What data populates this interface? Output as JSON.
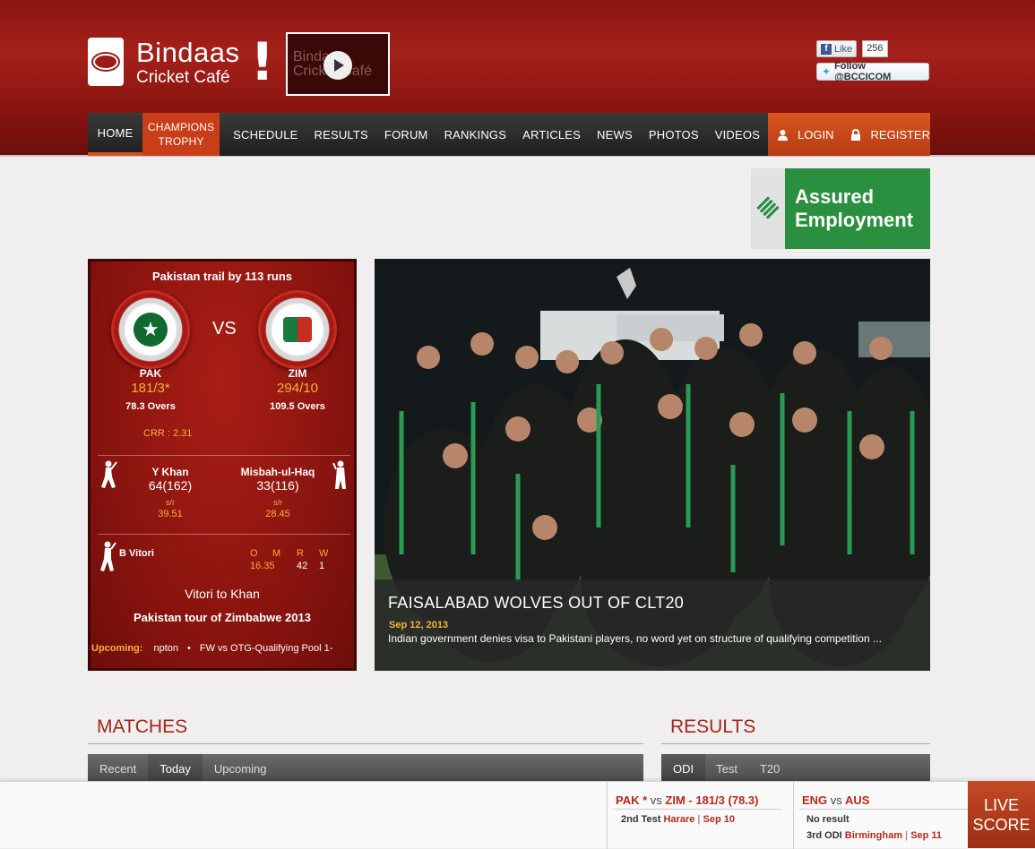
{
  "logo": {
    "line1": "Bindaas",
    "line2": "Cricket Café",
    "bang": "!"
  },
  "video": {
    "ghost_text": "Bindaas Cricket Café"
  },
  "social": {
    "fb_like": "Like",
    "fb_count": "256",
    "twitter": "Follow @BCCICOM"
  },
  "nav": {
    "items": [
      "HOME",
      "CHAMPIONS TROPHY",
      "SCHEDULE",
      "RESULTS",
      "FORUM",
      "RANKINGS",
      "ARTICLES",
      "NEWS",
      "PHOTOS",
      "VIDEOS"
    ],
    "champions_line1": "CHAMPIONS",
    "champions_line2": "TROPHY",
    "login": "LOGIN",
    "register": "REGISTER"
  },
  "ad": {
    "line1": "Assured",
    "line2": "Employment",
    "brand_color": "#2a8f3f"
  },
  "scorecard": {
    "status": "Pakistan trail by 113 runs",
    "vs": "VS",
    "team1": {
      "code": "PAK",
      "score": "181/3*",
      "overs": "78.3 Overs"
    },
    "team2": {
      "code": "ZIM",
      "score": "294/10",
      "overs": "109.5 Overs"
    },
    "crr": "CRR : 2.31",
    "batsman1": {
      "name": "Y Khan",
      "score": "64(162)",
      "sr_label": "s/r",
      "sr": "39.51"
    },
    "batsman2": {
      "name": "Misbah-ul-Haq",
      "score": "33(116)",
      "sr_label": "s/r",
      "sr": "28.45"
    },
    "bowler": {
      "name": "B Vitori",
      "headers": [
        "O",
        "M",
        "R",
        "W"
      ],
      "values": [
        "16.35",
        "42",
        "1"
      ]
    },
    "commentary": "Vitori to Khan",
    "tour": "Pakistan tour of Zimbabwe 2013",
    "upcoming_label": "Upcoming:",
    "upcoming_items": [
      "npton",
      "FW vs OTG-Qualifying Pool 1-"
    ]
  },
  "feature": {
    "title": "FAISALABAD WOLVES OUT OF CLT20",
    "date": "Sep 12, 2013",
    "desc": "Indian government denies visa to Pakistani players, no word yet on structure of qualifying competition ..."
  },
  "matches": {
    "title": "MATCHES",
    "tabs": [
      "Recent",
      "Today",
      "Upcoming"
    ],
    "active_tab": "Today"
  },
  "results": {
    "title": "RESULTS",
    "tabs": [
      "ODI",
      "Test",
      "T20"
    ],
    "active_tab": "ODI"
  },
  "ticker": [
    {
      "team1": "PAK *",
      "vs": "vs",
      "team2": "ZIM",
      "score": "- 181/3 (78.3)",
      "line1_type": "2nd Test",
      "venue": "Harare",
      "sep": "|",
      "date": "Sep 10"
    },
    {
      "team1": "ENG",
      "vs": "vs",
      "team2": "AUS",
      "result": "No result",
      "line2_type": "3rd ODI",
      "venue": "Birmingham",
      "sep": "|",
      "date": "Sep 11"
    }
  ],
  "live_score": {
    "line1": "LIVE",
    "line2": "SCORE"
  }
}
